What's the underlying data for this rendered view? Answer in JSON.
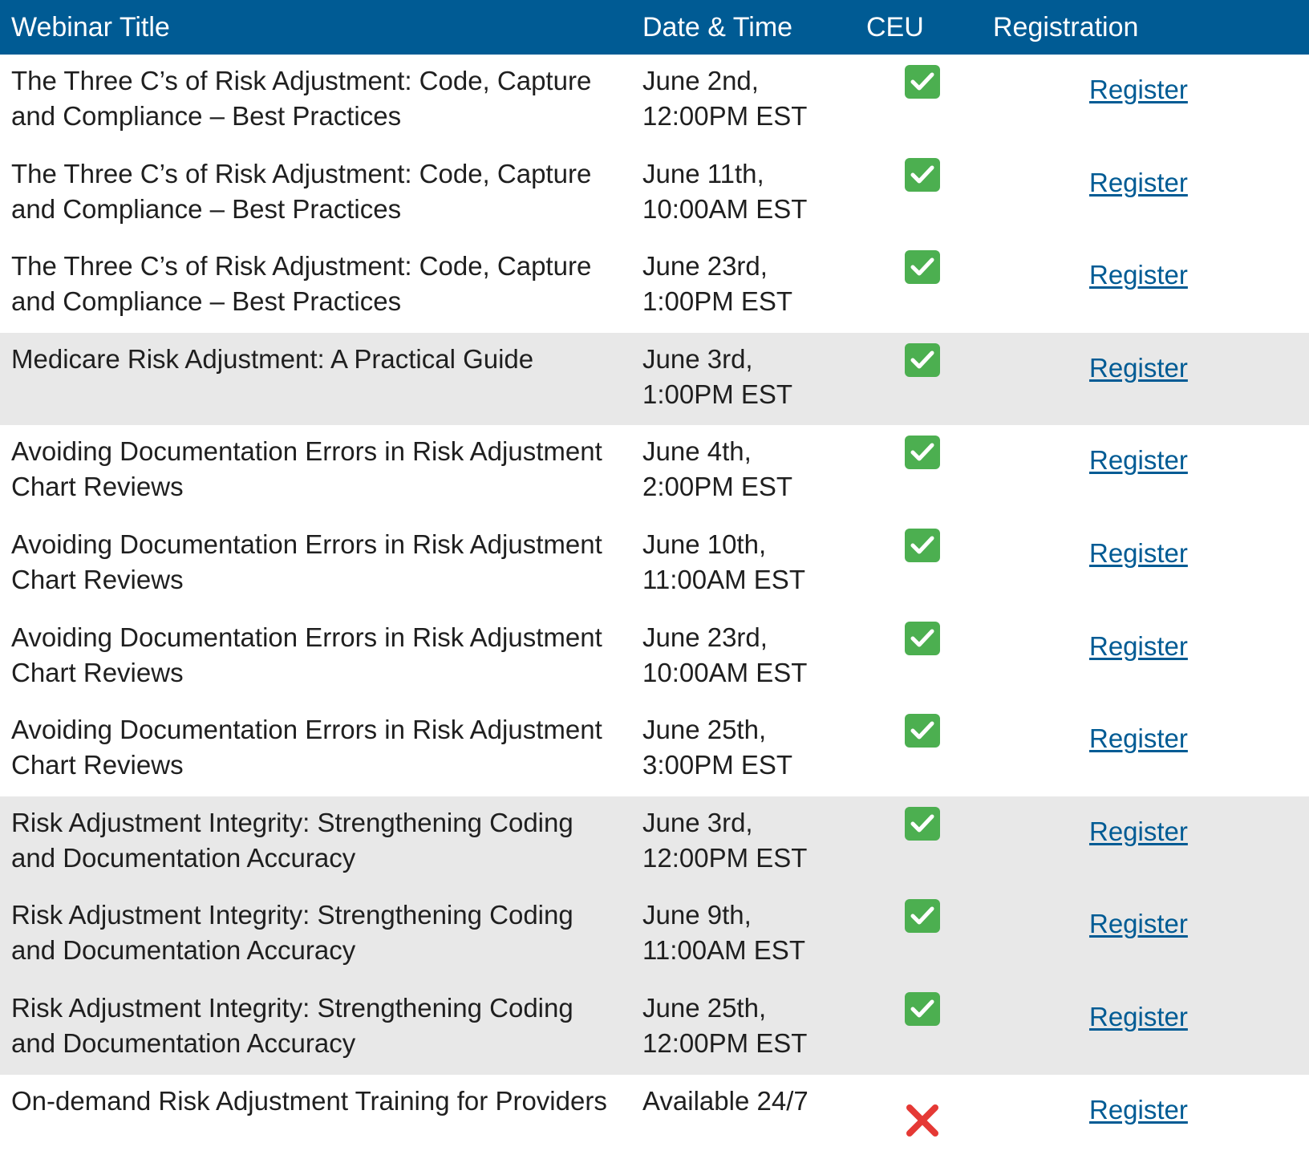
{
  "header": {
    "title": "Webinar Title",
    "date": "Date & Time",
    "ceu": "CEU",
    "registration": "Registration"
  },
  "colors": {
    "header_bg": "#005b94",
    "link": "#005b94",
    "shaded_row": "#e8e8e8",
    "check": "#4caf50",
    "cross": "#e53935"
  },
  "rows": [
    {
      "title": "The Three C’s of Risk Adjustment: Code, Capture and Compliance – Best Practices",
      "date_line1": "June 2nd,",
      "date_line2": "12:00PM EST",
      "ceu": "check-icon",
      "link": "Register",
      "shaded": false
    },
    {
      "title": "The Three C’s of Risk Adjustment: Code, Capture and Compliance – Best Practices",
      "date_line1": "June 11th,",
      "date_line2": "10:00AM EST",
      "ceu": "check-icon",
      "link": "Register",
      "shaded": false
    },
    {
      "title": "The Three C’s of Risk Adjustment: Code, Capture and Compliance – Best Practices",
      "date_line1": "June 23rd,",
      "date_line2": "1:00PM EST",
      "ceu": "check-icon",
      "link": "Register",
      "shaded": false
    },
    {
      "title": "Medicare Risk Adjustment: A Practical Guide",
      "date_line1": "June 3rd,",
      "date_line2": "1:00PM EST",
      "ceu": "check-icon",
      "link": "Register",
      "shaded": true
    },
    {
      "title": "Avoiding Documentation Errors in Risk Adjustment Chart Reviews",
      "date_line1": "June 4th,",
      "date_line2": "2:00PM EST",
      "ceu": "check-icon",
      "link": "Register",
      "shaded": false
    },
    {
      "title": "Avoiding Documentation Errors in Risk Adjustment Chart Reviews",
      "date_line1": "June 10th,",
      "date_line2": "11:00AM EST",
      "ceu": "check-icon",
      "link": "Register",
      "shaded": false
    },
    {
      "title": "Avoiding Documentation Errors in Risk Adjustment Chart Reviews",
      "date_line1": "June 23rd,",
      "date_line2": "10:00AM EST",
      "ceu": "check-icon",
      "link": "Register",
      "shaded": false
    },
    {
      "title": "Avoiding Documentation Errors in Risk Adjustment Chart Reviews",
      "date_line1": "June 25th,",
      "date_line2": "3:00PM EST",
      "ceu": "check-icon",
      "link": "Register",
      "shaded": false
    },
    {
      "title": "Risk Adjustment Integrity: Strengthening Coding and Documentation Accuracy",
      "date_line1": "June 3rd,",
      "date_line2": "12:00PM EST",
      "ceu": "check-icon",
      "link": "Register",
      "shaded": true
    },
    {
      "title": "Risk Adjustment Integrity: Strengthening Coding and Documentation Accuracy",
      "date_line1": "June 9th,",
      "date_line2": "11:00AM EST",
      "ceu": "check-icon",
      "link": "Register",
      "shaded": true
    },
    {
      "title": "Risk Adjustment Integrity: Strengthening Coding and Documentation Accuracy",
      "date_line1": "June 25th,",
      "date_line2": "12:00PM EST",
      "ceu": "check-icon",
      "link": "Register",
      "shaded": true
    },
    {
      "title": "On-demand Risk Adjustment Training for Providers",
      "date_line1": "Available 24/7",
      "date_line2": "",
      "ceu": "cross-icon",
      "link": "Register",
      "shaded": false
    }
  ]
}
